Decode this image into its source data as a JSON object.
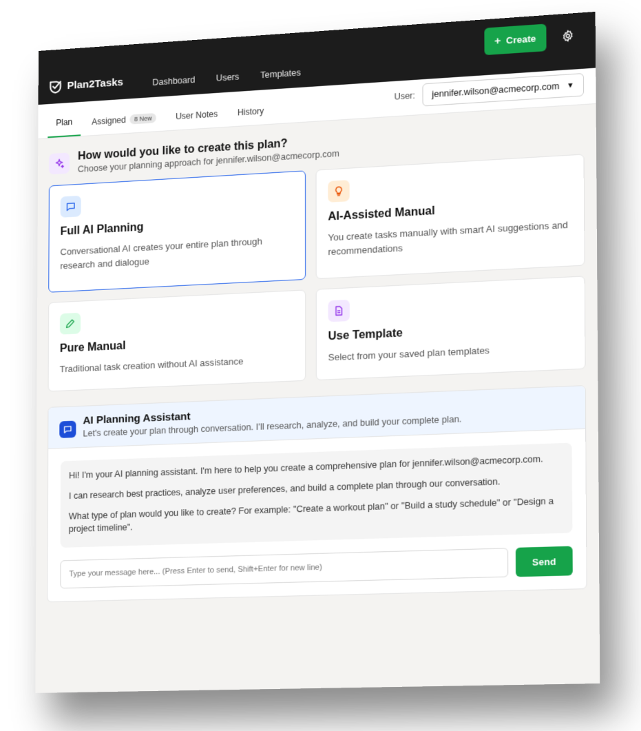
{
  "brand": {
    "name": "Plan2Tasks"
  },
  "nav": {
    "items": [
      "Dashboard",
      "Users",
      "Templates"
    ]
  },
  "header": {
    "create_label": "Create"
  },
  "tabs": [
    {
      "label": "Plan",
      "active": true
    },
    {
      "label": "Assigned",
      "badge": "8 New"
    },
    {
      "label": "User Notes"
    },
    {
      "label": "History"
    }
  ],
  "user": {
    "label": "User:",
    "selected": "jennifer.wilson@acmecorp.com"
  },
  "intro": {
    "title": "How would you like to create this plan?",
    "subtitle": "Choose your planning approach for jennifer.wilson@acmecorp.com"
  },
  "options": [
    {
      "title": "Full AI Planning",
      "desc": "Conversational AI creates your entire plan through research and dialogue",
      "icon": "chat-icon",
      "color": "#dbeafe"
    },
    {
      "title": "AI-Assisted Manual",
      "desc": "You create tasks manually with smart AI suggestions and recommendations",
      "icon": "lightbulb-icon",
      "color": "#ffedd5"
    },
    {
      "title": "Pure Manual",
      "desc": "Traditional task creation without AI assistance",
      "icon": "pencil-icon",
      "color": "#dcfce7"
    },
    {
      "title": "Use Template",
      "desc": "Select from your saved plan templates",
      "icon": "document-icon",
      "color": "#f3e8ff"
    }
  ],
  "assistant": {
    "title": "AI Planning Assistant",
    "subtitle": "Let's create your plan through conversation. I'll research, analyze, and build your complete plan.",
    "messages": [
      "Hi! I'm your AI planning assistant. I'm here to help you create a comprehensive plan for jennifer.wilson@acmecorp.com.",
      "I can research best practices, analyze user preferences, and build a complete plan through our conversation.",
      "What type of plan would you like to create? For example: \"Create a workout plan\" or \"Build a study schedule\" or \"Design a project timeline\"."
    ],
    "input_placeholder": "Type your message here... (Press Enter to send, Shift+Enter for new line)",
    "send_label": "Send"
  },
  "colors": {
    "accent": "#16a34a",
    "selected_border": "#2563eb",
    "topbar": "#1c1c1c"
  }
}
